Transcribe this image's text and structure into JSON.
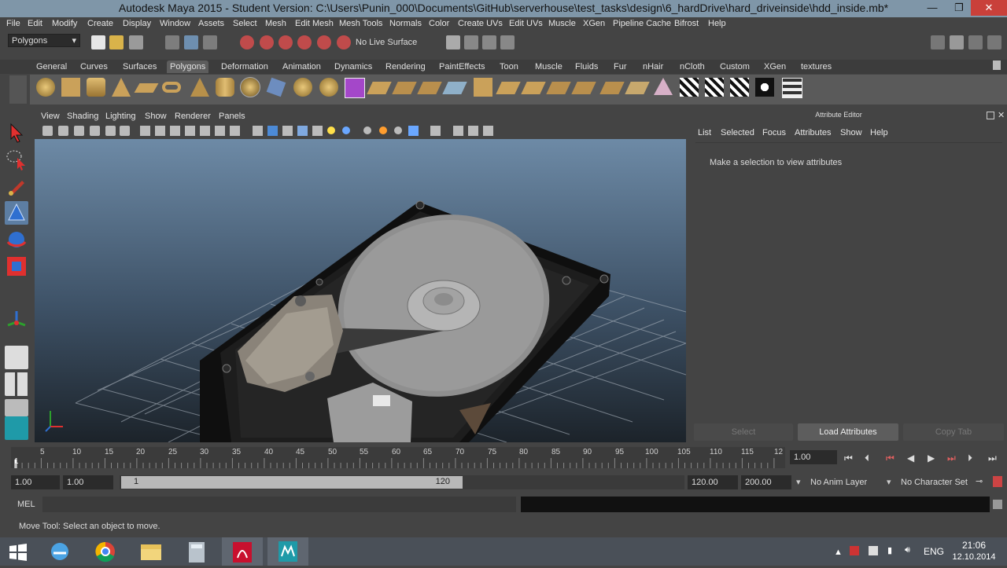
{
  "window": {
    "title": "Autodesk Maya 2015 - Student Version: C:\\Users\\Punin_000\\Documents\\GitHub\\serverhouse\\test_tasks\\design\\6_hardDrive\\hard_driveinside\\hdd_inside.mb*",
    "minimize": "—",
    "maximize": "❐",
    "close": "✕"
  },
  "menubar": [
    "File",
    "Edit",
    "Modify",
    "Create",
    "Display",
    "Window",
    "Assets",
    "Select",
    "Mesh",
    "Edit Mesh",
    "Mesh Tools",
    "Normals",
    "Color",
    "Create UVs",
    "Edit UVs",
    "Muscle",
    "XGen",
    "Pipeline Cache",
    "Bifrost",
    "Help"
  ],
  "statusline": {
    "mode": "Polygons",
    "live_surface": "No Live Surface"
  },
  "shelf_tabs": [
    "General",
    "Curves",
    "Surfaces",
    "Polygons",
    "Deformation",
    "Animation",
    "Dynamics",
    "Rendering",
    "PaintEffects",
    "Toon",
    "Muscle",
    "Fluids",
    "Fur",
    "nHair",
    "nCloth",
    "Custom",
    "XGen",
    "textures"
  ],
  "active_shelf_tab": "Polygons",
  "viewport_menu": [
    "View",
    "Shading",
    "Lighting",
    "Show",
    "Renderer",
    "Panels"
  ],
  "attribute_editor": {
    "title": "Attribute Editor",
    "menu": [
      "List",
      "Selected",
      "Focus",
      "Attributes",
      "Show",
      "Help"
    ],
    "message": "Make a selection to view attributes",
    "buttons": {
      "select": "Select",
      "load": "Load Attributes",
      "copy": "Copy Tab"
    }
  },
  "time_slider": {
    "ticks": [
      "5",
      "10",
      "15",
      "20",
      "25",
      "30",
      "35",
      "40",
      "45",
      "50",
      "55",
      "60",
      "65",
      "70",
      "75",
      "80",
      "85",
      "90",
      "95",
      "100",
      "105",
      "110",
      "115",
      "12"
    ],
    "first": "1",
    "current_frame": "1.00"
  },
  "range_slider": {
    "start": "1.00",
    "playback_start": "1.00",
    "thumb_start": "1",
    "thumb_end": "120",
    "playback_end": "120.00",
    "end": "200.00",
    "anim_layer": "No Anim Layer",
    "char_set": "No Character Set"
  },
  "command_line": {
    "label": "MEL"
  },
  "help_line": "Move Tool: Select an object to move.",
  "taskbar": {
    "lang": "ENG",
    "time": "21:06",
    "date": "12.10.2014"
  }
}
